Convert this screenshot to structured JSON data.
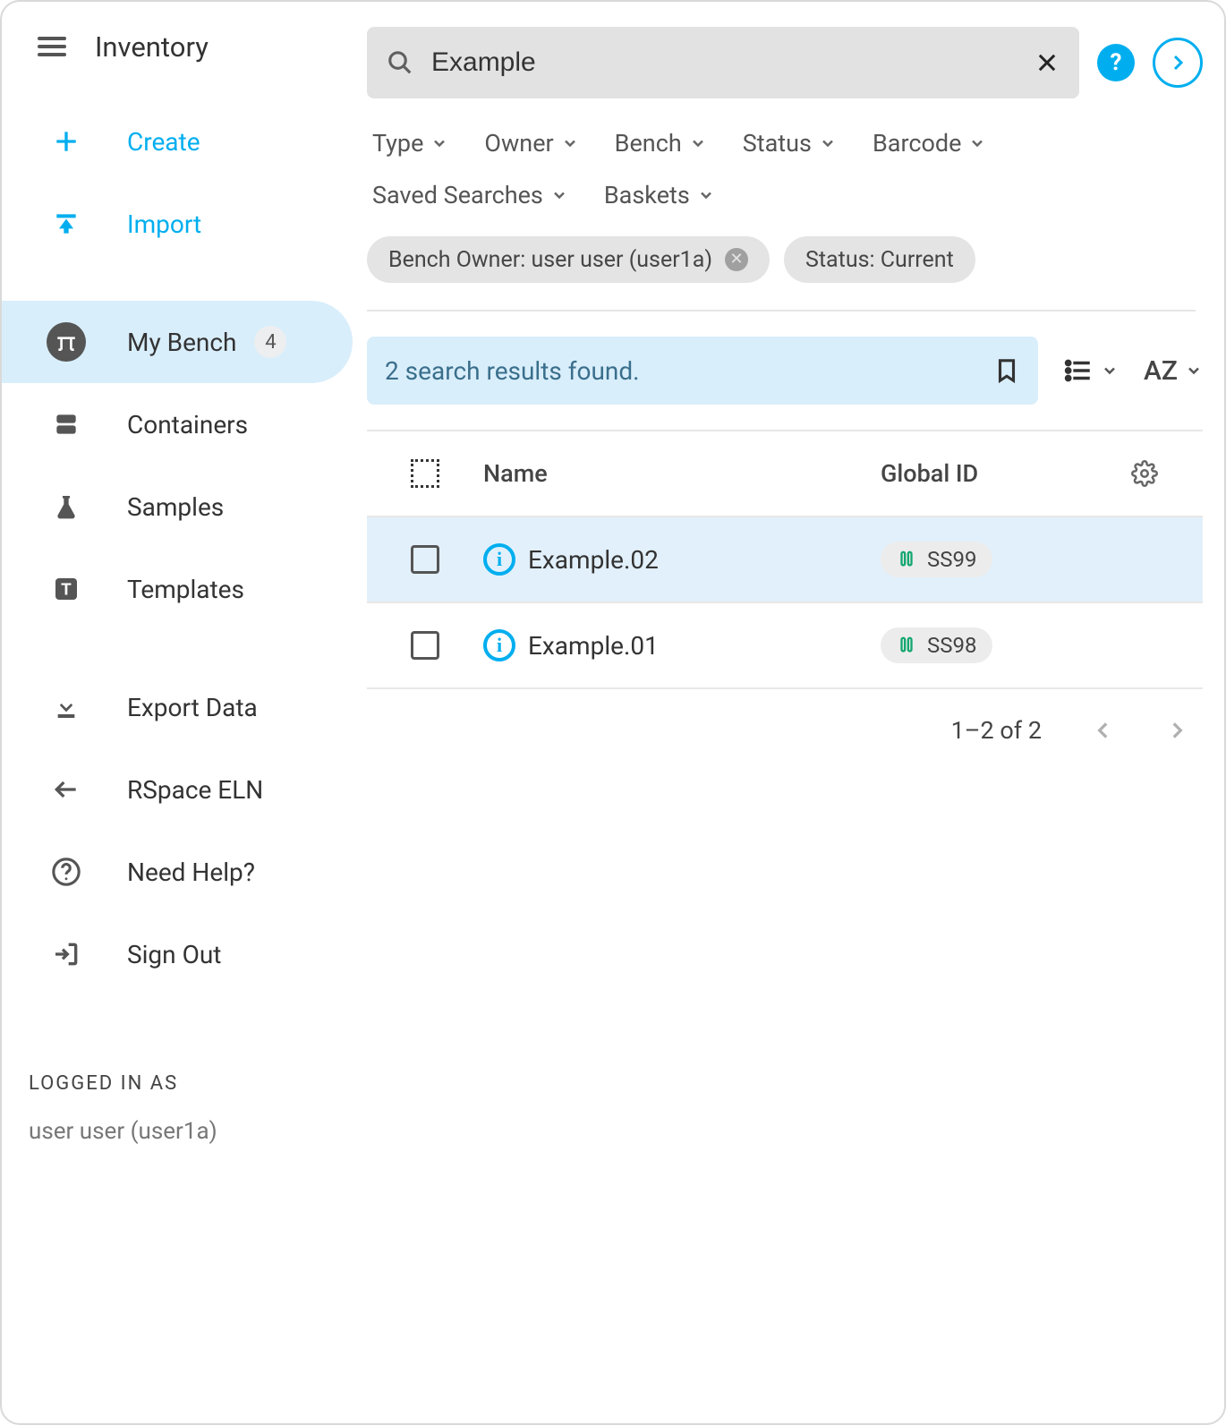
{
  "app": {
    "title": "Inventory"
  },
  "search": {
    "value": "Example"
  },
  "sidebar": {
    "create_label": "Create",
    "import_label": "Import",
    "mybench_label": "My Bench",
    "mybench_badge": "4",
    "containers_label": "Containers",
    "samples_label": "Samples",
    "templates_label": "Templates",
    "export_label": "Export Data",
    "rspace_label": "RSpace ELN",
    "help_label": "Need Help?",
    "signout_label": "Sign Out",
    "logged_in_label": "LOGGED IN AS",
    "logged_in_user": "user user (user1a)"
  },
  "filters": {
    "type": "Type",
    "owner": "Owner",
    "bench": "Bench",
    "status": "Status",
    "barcode": "Barcode",
    "saved": "Saved Searches",
    "baskets": "Baskets"
  },
  "chips": [
    {
      "label": "Bench Owner: user user (user1a)",
      "removable": true
    },
    {
      "label": "Status: Current",
      "removable": false
    }
  ],
  "results": {
    "summary": "2 search results found.",
    "sort_label": "AZ",
    "columns": {
      "name": "Name",
      "gid": "Global ID"
    },
    "rows": [
      {
        "name": "Example.02",
        "gid": "SS99",
        "selected": true
      },
      {
        "name": "Example.01",
        "gid": "SS98",
        "selected": false
      }
    ],
    "pagination": "1–2 of 2"
  }
}
